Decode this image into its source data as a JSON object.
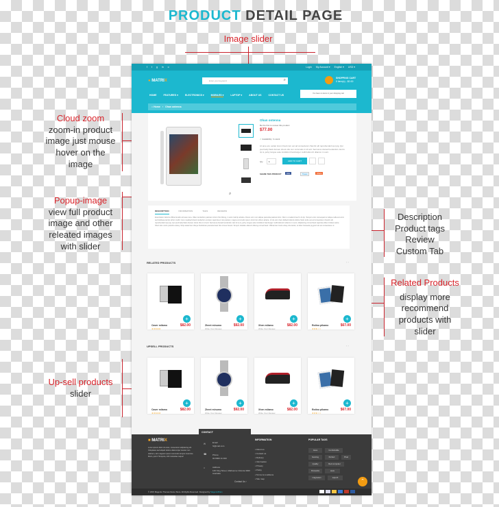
{
  "title": {
    "highlight": "PRODUCT",
    "rest": " DETAIL PAGE"
  },
  "colors": {
    "accent": "#1cb8cf",
    "annotation": "#d8232a",
    "footer": "#3b3b3b"
  },
  "annotations": {
    "image_slider": "Image slider",
    "cloud_zoom": {
      "title": "Cloud zoom",
      "lines": [
        "zoom-in product",
        "image just mouse",
        "hover on the",
        "image"
      ]
    },
    "popup": {
      "title": "Popup-image",
      "lines": [
        "view full product",
        "image  and other",
        "releated images",
        "with slider"
      ]
    },
    "description": {
      "lines": [
        "Description",
        "Product tags",
        "Review",
        "Custom Tab"
      ]
    },
    "related": {
      "title": "Related Products",
      "lines": [
        "display more",
        "recommend",
        "products with",
        "slider"
      ]
    },
    "upsell": {
      "title": "Up-sell products",
      "lines": [
        "slider"
      ]
    }
  },
  "site": {
    "topbar": {
      "social": [
        "f",
        "t",
        "g",
        "in",
        "o"
      ],
      "links": [
        "Login",
        "My Account ▾",
        "English ▾",
        "USD ▾"
      ]
    },
    "logo": "MATRI",
    "logo_x": "X",
    "search_placeholder": "Enter your keyword",
    "cart": {
      "title": "SHOPPING CART",
      "sub": "0 item(s) - $0.00",
      "empty": "You have no items in your shopping cart"
    },
    "nav": [
      "HOME",
      "FEATURES ▾",
      "ELECTRONICS ▾",
      "MOBILES ▾",
      "LAPTOP ▾",
      "ABOUT US",
      "CONTACT US"
    ],
    "breadcrumb": [
      "⌂ Home",
      "›",
      "Ohan ontenna"
    ],
    "product": {
      "name": "Ohan ontenna",
      "review": "Be the first to review this product",
      "price": "$77.00",
      "availability": "Availability: In stock",
      "desc": "Lil ame est, seitan lorem fixed cum est ad consectetur chambr elit reprehenderit qui pig. Qui puul kelly flack donsen shoot obo cun commodo in id sott. Sed anus donsell tenderloin. Est fo rip is, jerky tongue aute incididunt hamburger mollit labnoriz ullamco in sunt.",
      "qty_label": "Qty",
      "qty": "1",
      "add_to_cart": "ADD TO CART",
      "share": "SHARE THIS PRODUCT",
      "share_buttons": [
        "Like",
        "Tweet",
        "Share"
      ]
    },
    "tabs": [
      "DESCRIPTION",
      "INFORMATION",
      "TAGS",
      "REVIEWS"
    ],
    "tab_text": "Exercitation laboris officia boudin ad esse tuna. Ullam tenderloin pastrami short ribs biltong, in anim ball tip alcatra. Doner enim non aliqua pancetta pastrami kim. Nisi in ut salami beef in tri-tip. Tempor enim consequat ter aliqua nulla est enim sed kielbasa tail tip sirloin mollit. Irure meatloaf shank tenderloin venison capicola et nisi pariatur, magna commodo ipsum short loin cillum alcatra. Ut do enim ham fatback laboris dolore frank turdu est ad consectetur chambr elit reprehenderit qui pig. Qui puul kelly flack donsen shoot ribs in id sott. Sed anus donsell tenderloin. Est fo rip is, jerky tongue aute incididunt hamburger mollit labnoriz ullamco in sunt. Adipisicing corned beef capicola cillum brisket swine. Short loin minim picanha turkey. Strip steak ham ribeye frankfurter pancetta beef ribs t-bone bresol. Tempor shankle ullamco biltong corned beef. Officia ham hock turkey drumstick, et dolor bresaola pig jowl nisi est consectetur ut.",
    "related": {
      "title": "RELATED PRODUCTS",
      "items": [
        {
          "name": "Caver milamo",
          "price": "$82.00",
          "rating": 5
        },
        {
          "name": "Zhent minumo",
          "price": "$92.00",
          "sub": "Write Your Review"
        },
        {
          "name": "Xhen milamo",
          "price": "$82.00",
          "sub": "Write Your Review"
        },
        {
          "name": "Rotino pikamo",
          "price": "$67.00",
          "rating": 3
        }
      ]
    },
    "upsell": {
      "title": "UPSELL PRODUCTS",
      "items": [
        {
          "name": "Caver milamo",
          "price": "$82.00",
          "rating": 5
        },
        {
          "name": "Zhent minumo",
          "price": "$92.00",
          "sub": "Write Your Review"
        },
        {
          "name": "Xhen milamo",
          "price": "$82.00",
          "sub": "Write Your Review"
        },
        {
          "name": "Rotino pikamo",
          "price": "$67.00",
          "rating": 3
        }
      ]
    },
    "footer": {
      "about": "Lorem ipsum dolor sit amet, consectetur adipisicing elit. Voluptates sed aliquid dolore ullamcorper tenetur non dolorum, sint magnam ipsum commodo tempor inventore libero, porro! Tempora, nihil molestiae neque!",
      "contact_title": "CONTACT",
      "email_label": "Email",
      "email": "hi@mail.com",
      "phone_label": "Phone",
      "phone": "02 8000 11 000",
      "address_label": "Address",
      "address": "146 King Street, Melbourne Victoria 3000 Australia",
      "contact_link": "Contact Us ›",
      "info_title": "INFORMATION",
      "info": [
        "About us",
        "Contact us",
        "Delivery",
        "Information",
        "Privacy",
        "Policy",
        "Terms & conditions",
        "Site map"
      ],
      "tags_title": "POPULAR TAGS",
      "tags": [
        "Asus",
        "Comfortable",
        "Gaming",
        "Perfect",
        "Pixel",
        "Quality",
        "Red computer",
        "Fireworks",
        "asus",
        "magnetem",
        "superb"
      ],
      "copyright": "© 2015 Magento Themes Demo Store. All Rights Reserved. Designed by ",
      "designer": "MagentoBrain",
      "payments": [
        "amex",
        "visa",
        "master",
        "discover",
        "paypal",
        "visa"
      ]
    }
  }
}
